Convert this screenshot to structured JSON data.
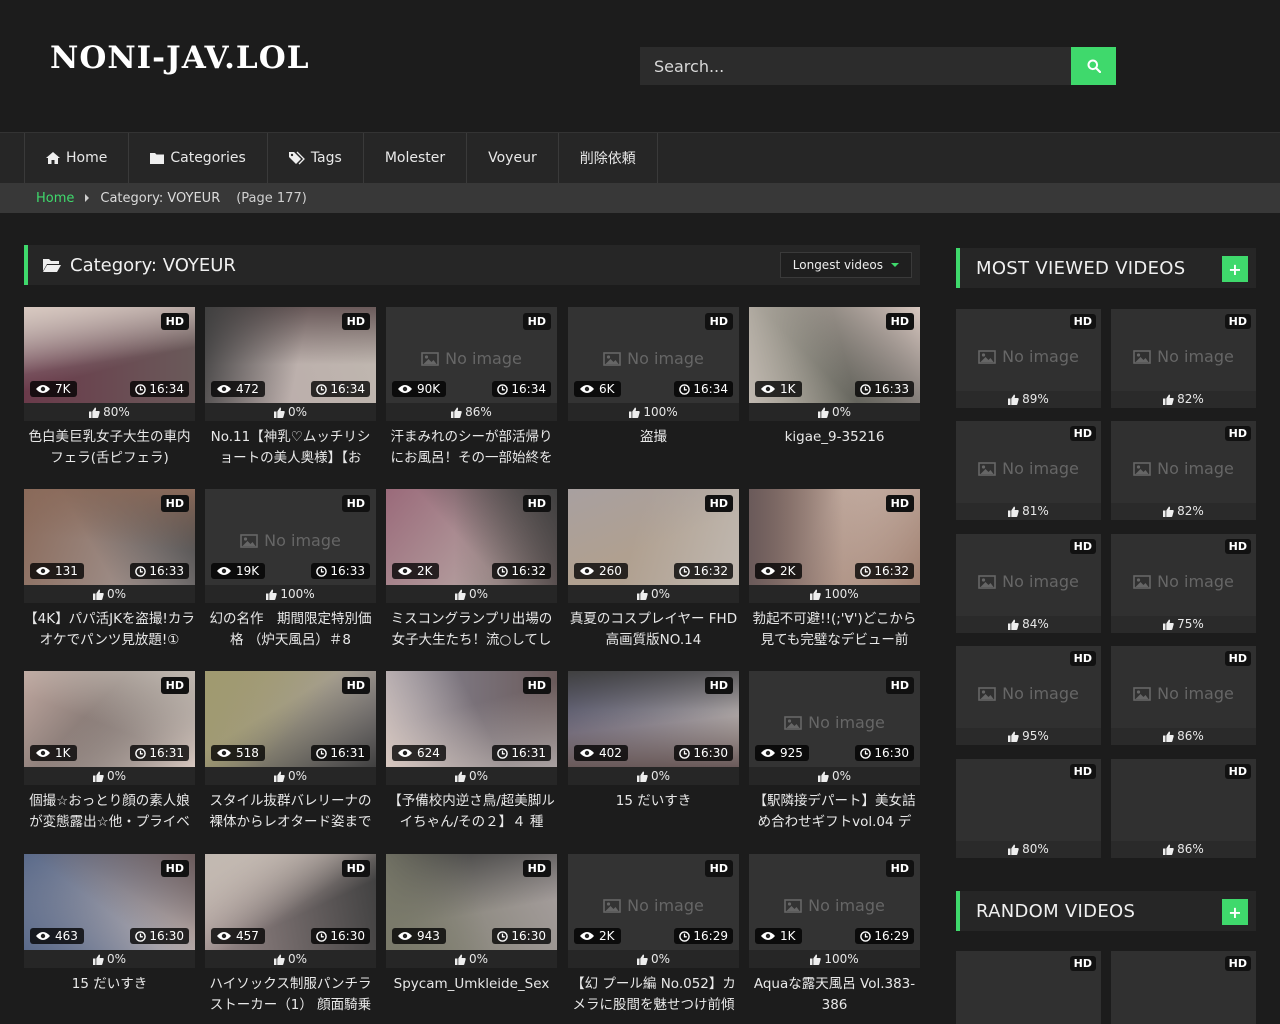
{
  "site": {
    "logo": "NONI-JAV.LOL"
  },
  "search": {
    "placeholder": "Search..."
  },
  "nav": [
    {
      "label": "Home",
      "icon": "home-icon"
    },
    {
      "label": "Categories",
      "icon": "folder-icon"
    },
    {
      "label": "Tags",
      "icon": "tag-icon"
    },
    {
      "label": "Molester",
      "icon": ""
    },
    {
      "label": "Voyeur",
      "icon": ""
    },
    {
      "label": "削除依頼",
      "icon": ""
    }
  ],
  "breadcrumb": {
    "home": "Home",
    "category": "Category: VOYEUR",
    "page": "(Page 177)"
  },
  "main": {
    "title": "Category: VOYEUR",
    "filter": "Longest videos"
  },
  "videos": [
    {
      "views": "7K",
      "duration": "16:34",
      "rating": "80%",
      "title": "色白美巨乳女子大生の車内フェラ(舌ピフェラ)",
      "hd": "HD",
      "image": true,
      "tone": "#6a3a4a"
    },
    {
      "views": "472",
      "duration": "16:34",
      "rating": "0%",
      "title": "No.11【神乳♡ムッチリショートの美人奥様】【お",
      "hd": "HD",
      "image": true,
      "tone": "#b8a8a8",
      "red": true
    },
    {
      "views": "90K",
      "duration": "16:34",
      "rating": "86%",
      "title": "汗まみれのシーが部活帰りにお風呂！その一部始終を",
      "hd": "HD",
      "image": false
    },
    {
      "views": "6K",
      "duration": "16:34",
      "rating": "100%",
      "title": "盗撮",
      "hd": "HD",
      "image": false
    },
    {
      "views": "1K",
      "duration": "16:33",
      "rating": "0%",
      "title": "kigae_9-35216",
      "hd": "HD",
      "image": true,
      "tone": "#8a8a7a"
    },
    {
      "views": "131",
      "duration": "16:33",
      "rating": "0%",
      "title": "【4K】パパ活JKを盗撮!カラオケでパンツ見放題!①",
      "hd": "HD",
      "image": true,
      "tone": "#8a6a5a"
    },
    {
      "views": "19K",
      "duration": "16:33",
      "rating": "100%",
      "title": "幻の名作　期間限定特別価格 （炉天風呂）＃8",
      "hd": "HD",
      "image": false
    },
    {
      "views": "2K",
      "duration": "16:32",
      "rating": "0%",
      "title": "ミスコングランプリ出場の女子大生たち！流○してし",
      "hd": "HD",
      "image": true,
      "tone": "#9a6a7a"
    },
    {
      "views": "260",
      "duration": "16:32",
      "rating": "0%",
      "title": "真夏のコスプレイヤー FHD高画質版NO.14",
      "hd": "HD",
      "image": true,
      "tone": "#b0a090"
    },
    {
      "views": "2K",
      "duration": "16:32",
      "rating": "100%",
      "title": "勃起不可避!!(;'∀')どこから見ても完璧なデビュー前",
      "hd": "HD",
      "image": true,
      "tone": "#a08070"
    },
    {
      "views": "1K",
      "duration": "16:31",
      "rating": "0%",
      "title": "個撮☆おっとり顔の素人娘が変態露出☆他・プライベ",
      "hd": "HD",
      "image": true,
      "tone": "#c0a8a0"
    },
    {
      "views": "518",
      "duration": "16:31",
      "rating": "0%",
      "title": "スタイル抜群バレリーナの裸体からレオタード姿まで",
      "hd": "HD",
      "image": true,
      "tone": "#a09a70"
    },
    {
      "views": "624",
      "duration": "16:31",
      "rating": "0%",
      "title": "【予備校内逆さ鳥/超美脚ルイちゃん/その２】４ 種",
      "hd": "HD",
      "image": true,
      "tone": "#8a8a9a"
    },
    {
      "views": "402",
      "duration": "16:30",
      "rating": "0%",
      "title": "15 だいすき",
      "hd": "HD",
      "image": true,
      "tone": "#6a6a8a"
    },
    {
      "views": "925",
      "duration": "16:30",
      "rating": "0%",
      "title": "【駅隣接デパート】美女詰め合わせギフトvol.04 デ",
      "hd": "HD",
      "image": false
    },
    {
      "views": "463",
      "duration": "16:30",
      "rating": "0%",
      "title": "15 だいすき",
      "hd": "HD",
      "image": true,
      "tone": "#5a6a8a"
    },
    {
      "views": "457",
      "duration": "16:30",
      "rating": "0%",
      "title": "ハイソックス制服パンチラストーカー（1） 顔面騎乗",
      "hd": "HD",
      "image": true,
      "tone": "#9a8a8a"
    },
    {
      "views": "943",
      "duration": "16:30",
      "rating": "0%",
      "title": "Spycam_Umkleide_Sex",
      "hd": "HD",
      "image": true,
      "tone": "#7a7a6a"
    },
    {
      "views": "2K",
      "duration": "16:29",
      "rating": "0%",
      "title": "【幻 プール編 No.052】カメラに股間を魅せつけ前傾",
      "hd": "HD",
      "image": false
    },
    {
      "views": "1K",
      "duration": "16:29",
      "rating": "100%",
      "title": "Aquaな露天風呂 Vol.383-386",
      "hd": "HD",
      "image": false
    }
  ],
  "no_image_text": "No image",
  "most_viewed": {
    "title": "MOST VIEWED VIDEOS",
    "items": [
      {
        "rating": "89%",
        "hd": "HD",
        "image": false
      },
      {
        "rating": "82%",
        "hd": "HD",
        "image": false
      },
      {
        "rating": "81%",
        "hd": "HD",
        "image": false
      },
      {
        "rating": "82%",
        "hd": "HD",
        "image": false
      },
      {
        "rating": "84%",
        "hd": "HD",
        "image": false
      },
      {
        "rating": "75%",
        "hd": "HD",
        "image": false
      },
      {
        "rating": "95%",
        "hd": "HD",
        "image": false
      },
      {
        "rating": "86%",
        "hd": "HD",
        "image": false
      },
      {
        "rating": "80%",
        "hd": "HD",
        "image": true,
        "tone": "#8a7a60"
      },
      {
        "rating": "86%",
        "hd": "HD",
        "image": true,
        "tone": "#c09a90"
      }
    ]
  },
  "random": {
    "title": "RANDOM VIDEOS",
    "items": [
      {
        "hd": "HD",
        "tone": "#4a4a40"
      },
      {
        "hd": "HD",
        "tone": "#7a5a4a"
      }
    ]
  },
  "colors": {
    "accent": "#3fd96c",
    "bg": "#1c1c1c",
    "panel": "#262626"
  }
}
